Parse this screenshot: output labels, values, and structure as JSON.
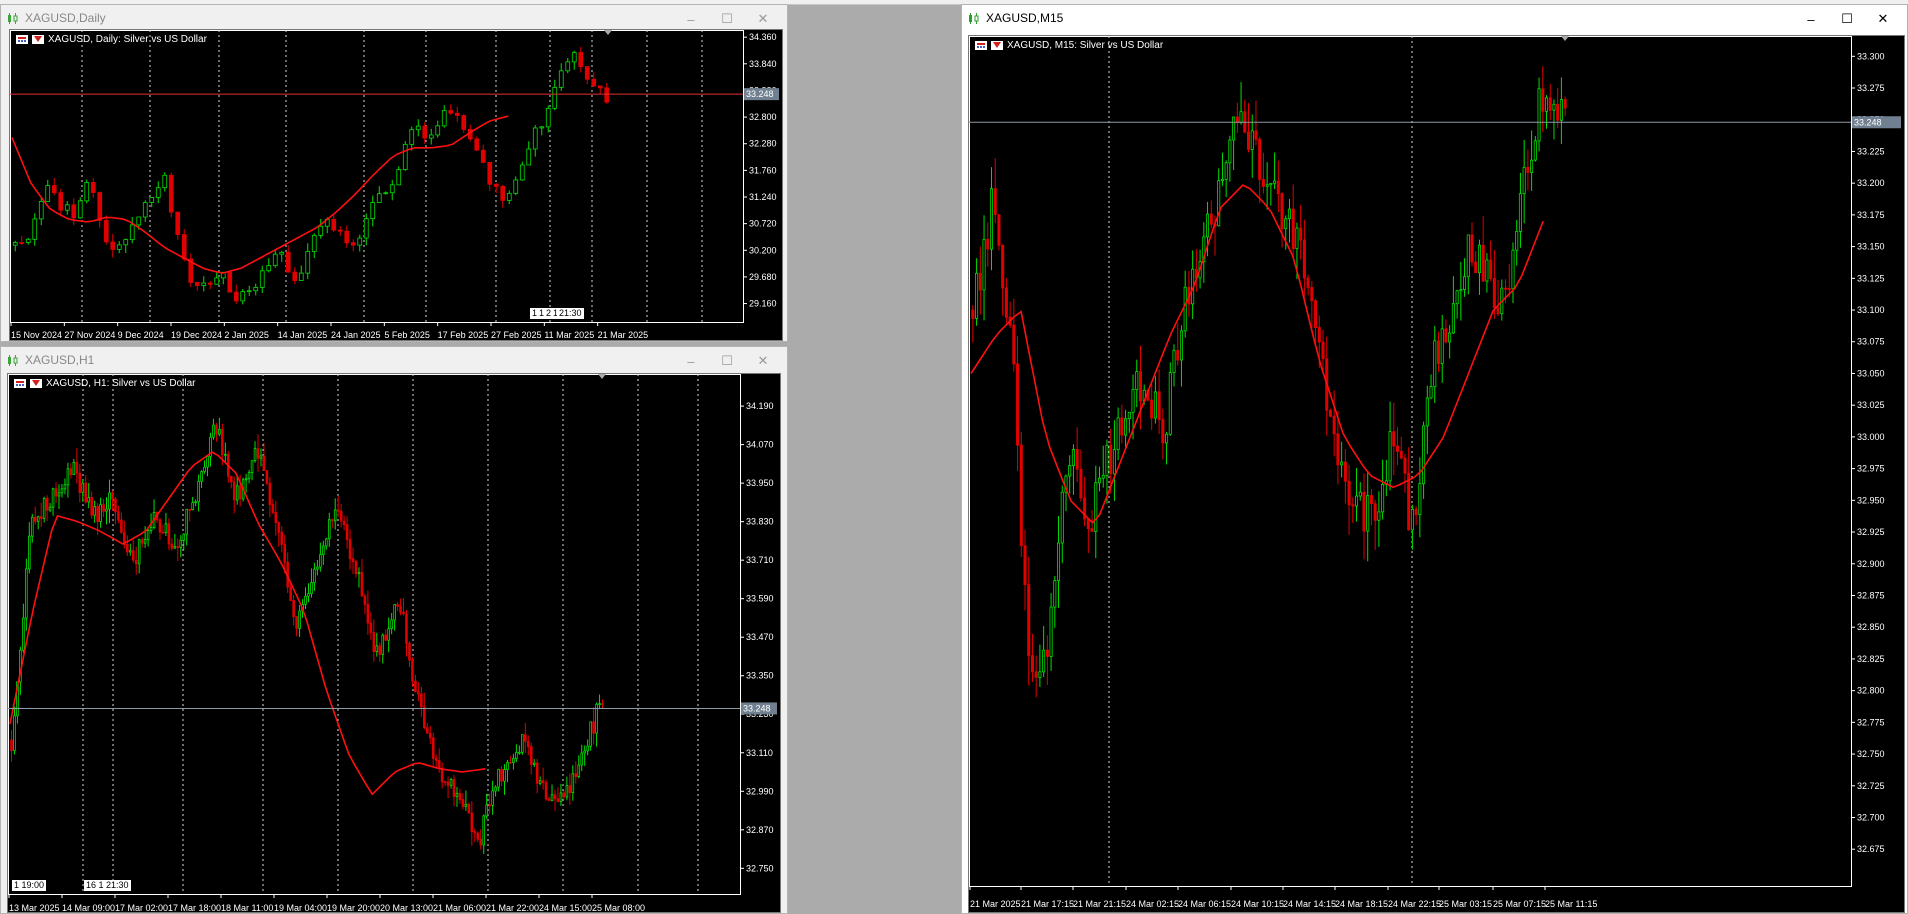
{
  "colors": {
    "bull": "#00e000",
    "bear": "#e00000",
    "ma": "#ff1010",
    "grid": "#d8d8d8",
    "axis": "#ffffff",
    "price_line": "#8e9aa6",
    "price_label_bg": "#708090"
  },
  "icons": {
    "window": "candlestick-icon",
    "header_a": "table-icon",
    "header_b": "triangle-icon"
  },
  "windows": [
    {
      "title": "XAGUSD,Daily",
      "header": "XAGUSD, Daily:  Silver vs US Dollar",
      "price_label": "33.248",
      "decorations": [
        "1",
        "1",
        "2",
        "1",
        "21:30"
      ],
      "chart_data": {
        "type": "candlestick",
        "symbol": "XAGUSD",
        "timeframe": "Daily",
        "ylim": [
          28.8,
          34.5
        ],
        "y_ticks": [
          "34.360",
          "33.840",
          "33.320",
          "32.800",
          "32.280",
          "31.760",
          "31.240",
          "30.720",
          "30.200",
          "29.680",
          "29.160"
        ],
        "x_labels": [
          "15 Nov 2024",
          "27 Nov 2024",
          "9 Dec 2024",
          "19 Dec 2024",
          "2 Jan 2025",
          "14 Jan 2025",
          "24 Jan 2025",
          "5 Feb 2025",
          "17 Feb 2025",
          "27 Feb 2025",
          "11 Mar 2025",
          "21 Mar 2025"
        ],
        "current_price": 33.248,
        "grid_lines": 11,
        "candle_count": 92,
        "trend": [
          30.3,
          30.5,
          31.5,
          31.1,
          30.9,
          31.6,
          30.5,
          30.2,
          30.8,
          31.2,
          31.7,
          30.5,
          29.3,
          29.6,
          29.8,
          29.2,
          29.4,
          29.9,
          30.1,
          29.6,
          30.3,
          30.9,
          30.5,
          30.2,
          31.0,
          31.3,
          31.9,
          32.6,
          32.3,
          32.9,
          32.8,
          32.2,
          31.6,
          31.1,
          31.8,
          32.4,
          32.9,
          33.8,
          34.0,
          33.4,
          33.15
        ],
        "ma": [
          32.4,
          31.5,
          31.0,
          30.8,
          30.75,
          30.85,
          30.8,
          30.55,
          30.25,
          30.05,
          29.85,
          29.75,
          29.85,
          30.05,
          30.25,
          30.45,
          30.65,
          30.95,
          31.3,
          31.7,
          32.05,
          32.2,
          32.2,
          32.25,
          32.5,
          32.72,
          32.82
        ],
        "ma_span": [
          0,
          0.83
        ]
      }
    },
    {
      "title": "XAGUSD,H1",
      "header": "XAGUSD, H1:  Silver vs US Dollar",
      "price_label": "33.248",
      "decorations": [
        "1 19:00",
        "16 1 21:30"
      ],
      "chart_data": {
        "type": "candlestick",
        "symbol": "XAGUSD",
        "timeframe": "H1",
        "ylim": [
          32.67,
          34.29
        ],
        "y_ticks": [
          "34.190",
          "34.070",
          "33.950",
          "33.830",
          "33.710",
          "33.590",
          "33.470",
          "33.350",
          "33.230",
          "33.110",
          "32.990",
          "32.870",
          "32.750"
        ],
        "x_labels": [
          "13 Mar 2025",
          "14 Mar 09:00",
          "17 Mar 02:00",
          "17 Mar 18:00",
          "18 Mar 11:00",
          "19 Mar 04:00",
          "19 Mar 20:00",
          "20 Mar 13:00",
          "21 Mar 06:00",
          "21 Mar 22:00",
          "24 Mar 15:00",
          "25 Mar 08:00"
        ],
        "current_price": 33.248,
        "grid_lines": 11,
        "candle_count": 200,
        "trend": [
          33.15,
          33.85,
          33.9,
          34.0,
          33.85,
          33.9,
          33.7,
          33.85,
          33.75,
          33.9,
          34.15,
          33.9,
          34.05,
          33.85,
          33.5,
          33.7,
          33.9,
          33.65,
          33.4,
          33.6,
          33.25,
          33.05,
          32.95,
          32.85,
          33.05,
          33.15,
          33.0,
          32.95,
          33.1,
          33.28
        ],
        "ma": [
          33.2,
          33.55,
          33.85,
          33.83,
          33.8,
          33.76,
          33.8,
          33.9,
          34.0,
          34.05,
          33.98,
          33.82,
          33.7,
          33.55,
          33.3,
          33.1,
          32.98,
          33.05,
          33.08,
          33.06,
          33.05,
          33.06
        ],
        "ma_span": [
          0,
          0.8
        ]
      }
    },
    {
      "title": "XAGUSD,M15",
      "header": "XAGUSD, M15:  Silver vs US Dollar",
      "price_label": "33.248",
      "decorations": [],
      "chart_data": {
        "type": "candlestick",
        "symbol": "XAGUSD",
        "timeframe": "M15",
        "ylim": [
          32.646,
          33.316
        ],
        "y_ticks": [
          "33.300",
          "33.275",
          "33.250",
          "33.225",
          "33.200",
          "33.175",
          "33.150",
          "33.125",
          "33.100",
          "33.075",
          "33.050",
          "33.025",
          "33.000",
          "32.975",
          "32.950",
          "32.925",
          "32.900",
          "32.875",
          "32.850",
          "32.825",
          "32.800",
          "32.775",
          "32.750",
          "32.725",
          "32.700",
          "32.675"
        ],
        "x_labels": [
          "21 Mar 2025",
          "21 Mar 17:15",
          "21 Mar 21:15",
          "24 Mar 02:15",
          "24 Mar 06:15",
          "24 Mar 10:15",
          "24 Mar 14:15",
          "24 Mar 18:15",
          "24 Mar 22:15",
          "25 Mar 03:15",
          "25 Mar 07:15",
          "25 Mar 11:15"
        ],
        "current_price": 33.248,
        "grid_lines": [
          2,
          8
        ],
        "candle_count": 160,
        "trend": [
          33.1,
          33.18,
          33.08,
          32.8,
          32.85,
          33.0,
          32.93,
          32.98,
          33.02,
          33.05,
          33.0,
          33.1,
          33.15,
          33.2,
          33.26,
          33.22,
          33.18,
          33.15,
          33.08,
          32.98,
          32.95,
          32.93,
          33.0,
          32.93,
          33.05,
          33.1,
          33.15,
          33.12,
          33.1,
          33.22,
          33.28,
          33.25
        ],
        "ma": [
          33.05,
          33.08,
          33.1,
          33.0,
          32.95,
          32.93,
          32.98,
          33.03,
          33.08,
          33.12,
          33.18,
          33.2,
          33.18,
          33.14,
          33.06,
          33.0,
          32.97,
          32.96,
          32.97,
          33.0,
          33.05,
          33.1,
          33.12,
          33.17
        ],
        "ma_span": [
          0,
          0.96
        ]
      }
    }
  ]
}
